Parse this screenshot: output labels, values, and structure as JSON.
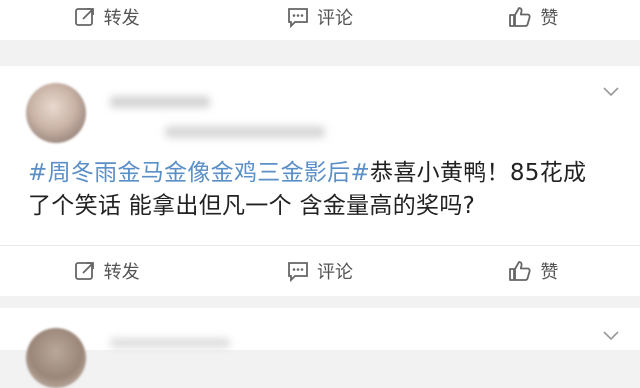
{
  "actions_top": [
    {
      "icon": "share-icon",
      "label": "转发"
    },
    {
      "icon": "comment-icon",
      "label": "评论"
    },
    {
      "icon": "like-icon",
      "label": "赞"
    }
  ],
  "post": {
    "hashtag": "#周冬雨金马金像金鸡三金影后#",
    "text_line1": "恭喜小黄鸭！85花成",
    "text_line2": "了个笑话 能拿出但凡一个 含金量高的奖吗?",
    "actions": [
      {
        "icon": "share-icon",
        "label": "转发"
      },
      {
        "icon": "comment-icon",
        "label": "评论"
      },
      {
        "icon": "like-icon",
        "label": "赞"
      }
    ]
  },
  "colors": {
    "hashtag": "#5a8fc7",
    "background": "#f2f2f2"
  }
}
